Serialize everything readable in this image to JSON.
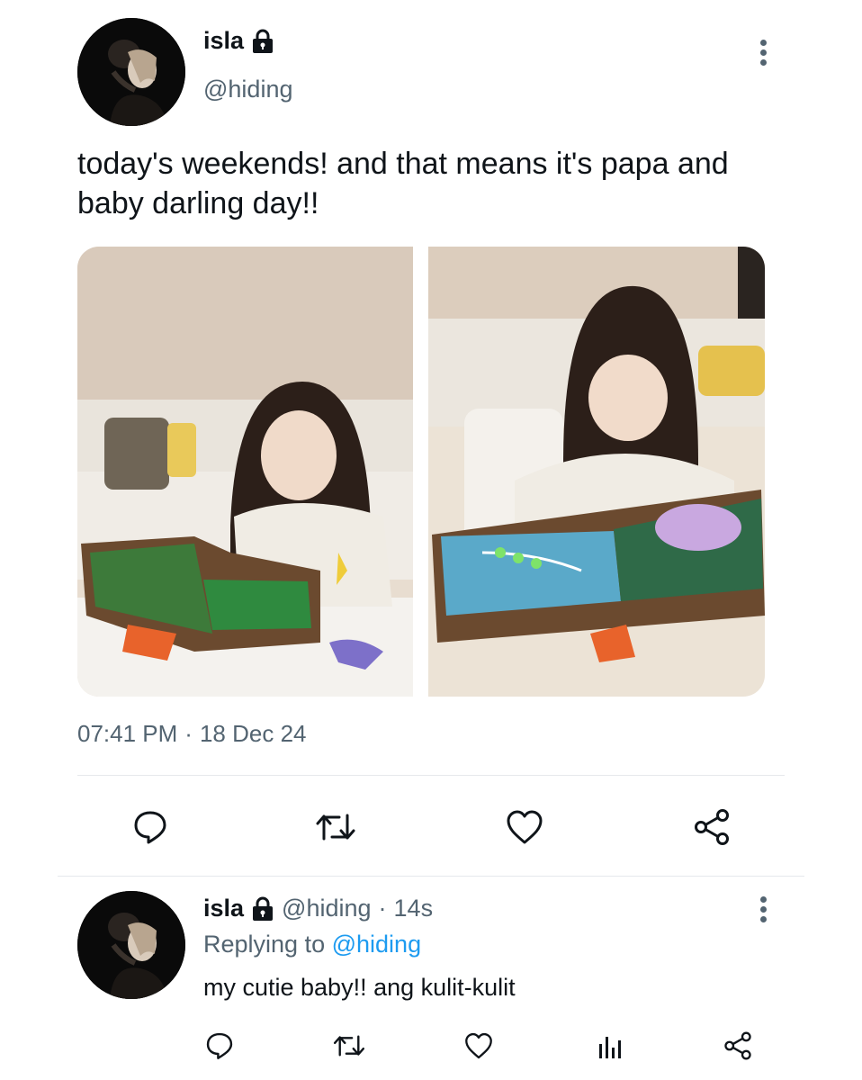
{
  "tweet": {
    "author_name": "isla",
    "author_handle": "@hiding",
    "text": "today's weekends! and that means it's papa and baby darling day!!",
    "time": "07:41 PM",
    "separator": "·",
    "date": "18 Dec 24"
  },
  "reply": {
    "author_name": "isla",
    "author_handle": "@hiding",
    "separator": "·",
    "age": "14s",
    "replying_prefix": "Replying to",
    "replying_to": "@hiding",
    "text": "my cutie baby!! ang kulit-kulit"
  },
  "icons": {
    "lock": "lock-icon",
    "more": "more-vertical-icon",
    "reply": "comment-icon",
    "retweet": "retweet-icon",
    "like": "heart-icon",
    "analytics": "analytics-icon",
    "share": "share-icon"
  },
  "colors": {
    "text_primary": "#0f1419",
    "text_secondary": "#536471",
    "link": "#1d9bf0",
    "divider": "#e6e9ec"
  }
}
